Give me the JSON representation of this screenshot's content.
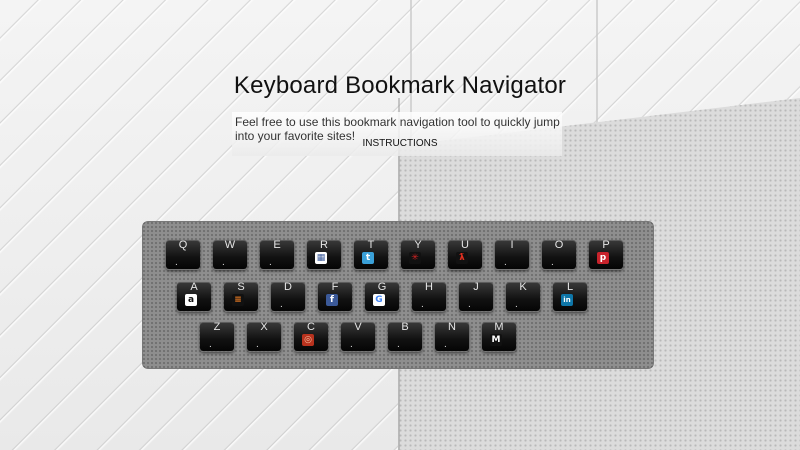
{
  "page": {
    "title": "Keyboard Bookmark Navigator",
    "description": "Feel free to use this bookmark navigation tool to quickly jump into your favorite sites!",
    "instructions_label": "INSTRUCTIONS"
  },
  "keyboard": {
    "rows": [
      [
        {
          "letter": "Q",
          "icon": null
        },
        {
          "letter": "W",
          "icon": null
        },
        {
          "letter": "E",
          "icon": null
        },
        {
          "letter": "R",
          "icon": "reddit-icon"
        },
        {
          "letter": "T",
          "icon": "twitter-icon"
        },
        {
          "letter": "Y",
          "icon": "yelp-icon"
        },
        {
          "letter": "U",
          "icon": "unknown-red-icon"
        },
        {
          "letter": "I",
          "icon": null
        },
        {
          "letter": "O",
          "icon": null
        },
        {
          "letter": "P",
          "icon": "pinterest-icon"
        }
      ],
      [
        {
          "letter": "A",
          "icon": "amazon-icon"
        },
        {
          "letter": "S",
          "icon": "stack-overflow-icon"
        },
        {
          "letter": "D",
          "icon": null
        },
        {
          "letter": "F",
          "icon": "facebook-icon"
        },
        {
          "letter": "G",
          "icon": "google-icon"
        },
        {
          "letter": "H",
          "icon": null
        },
        {
          "letter": "J",
          "icon": null
        },
        {
          "letter": "K",
          "icon": null
        },
        {
          "letter": "L",
          "icon": "linkedin-icon"
        }
      ],
      [
        {
          "letter": "Z",
          "icon": null
        },
        {
          "letter": "X",
          "icon": null
        },
        {
          "letter": "C",
          "icon": "c-red-icon"
        },
        {
          "letter": "V",
          "icon": null
        },
        {
          "letter": "B",
          "icon": null
        },
        {
          "letter": "N",
          "icon": null
        },
        {
          "letter": "M",
          "icon": "medium-icon"
        }
      ]
    ],
    "dot": "."
  },
  "colors": {
    "keyboard_bg": "#8e8e8e",
    "key_face": "#111111",
    "key_text": "#e6e6e6",
    "title_text": "#111111"
  }
}
